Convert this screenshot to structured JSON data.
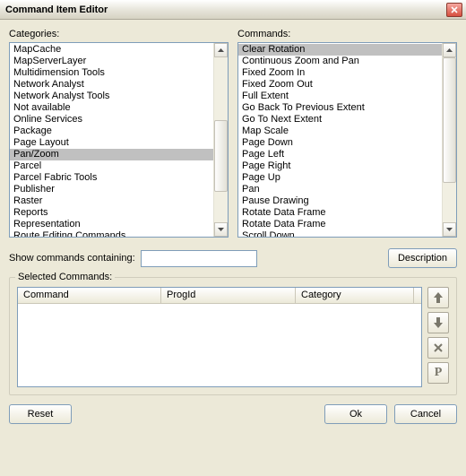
{
  "window": {
    "title": "Command Item Editor"
  },
  "labels": {
    "categories": "Categories:",
    "commands": "Commands:",
    "filter": "Show commands containing:",
    "selected": "Selected Commands:"
  },
  "buttons": {
    "description": "Description",
    "reset": "Reset",
    "ok": "Ok",
    "cancel": "Cancel"
  },
  "filter": {
    "value": ""
  },
  "categories": {
    "selectedIndex": 9,
    "items": [
      "MapCache",
      "MapServerLayer",
      "Multidimension Tools",
      "Network Analyst",
      "Network Analyst Tools",
      "Not available",
      "Online Services",
      "Package",
      "Page Layout",
      "Pan/Zoom",
      "Parcel",
      "Parcel Fabric Tools",
      "Publisher",
      "Raster",
      "Reports",
      "Representation",
      "Route Editing Commands"
    ]
  },
  "commands": {
    "selectedIndex": 0,
    "items": [
      "Clear Rotation",
      "Continuous Zoom and Pan",
      "Fixed Zoom In",
      "Fixed Zoom Out",
      "Full Extent",
      "Go Back To Previous Extent",
      "Go To Next Extent",
      "Map Scale",
      "Page Down",
      "Page Left",
      "Page Right",
      "Page Up",
      "Pan",
      "Pause Drawing",
      "Rotate Data Frame",
      "Rotate Data Frame",
      "Scroll Down"
    ]
  },
  "selectedTable": {
    "columns": [
      "Command",
      "ProgId",
      "Category"
    ],
    "rows": []
  },
  "sideButtons": {
    "up": "↑",
    "down": "↓",
    "delete": "×",
    "props": "P"
  }
}
